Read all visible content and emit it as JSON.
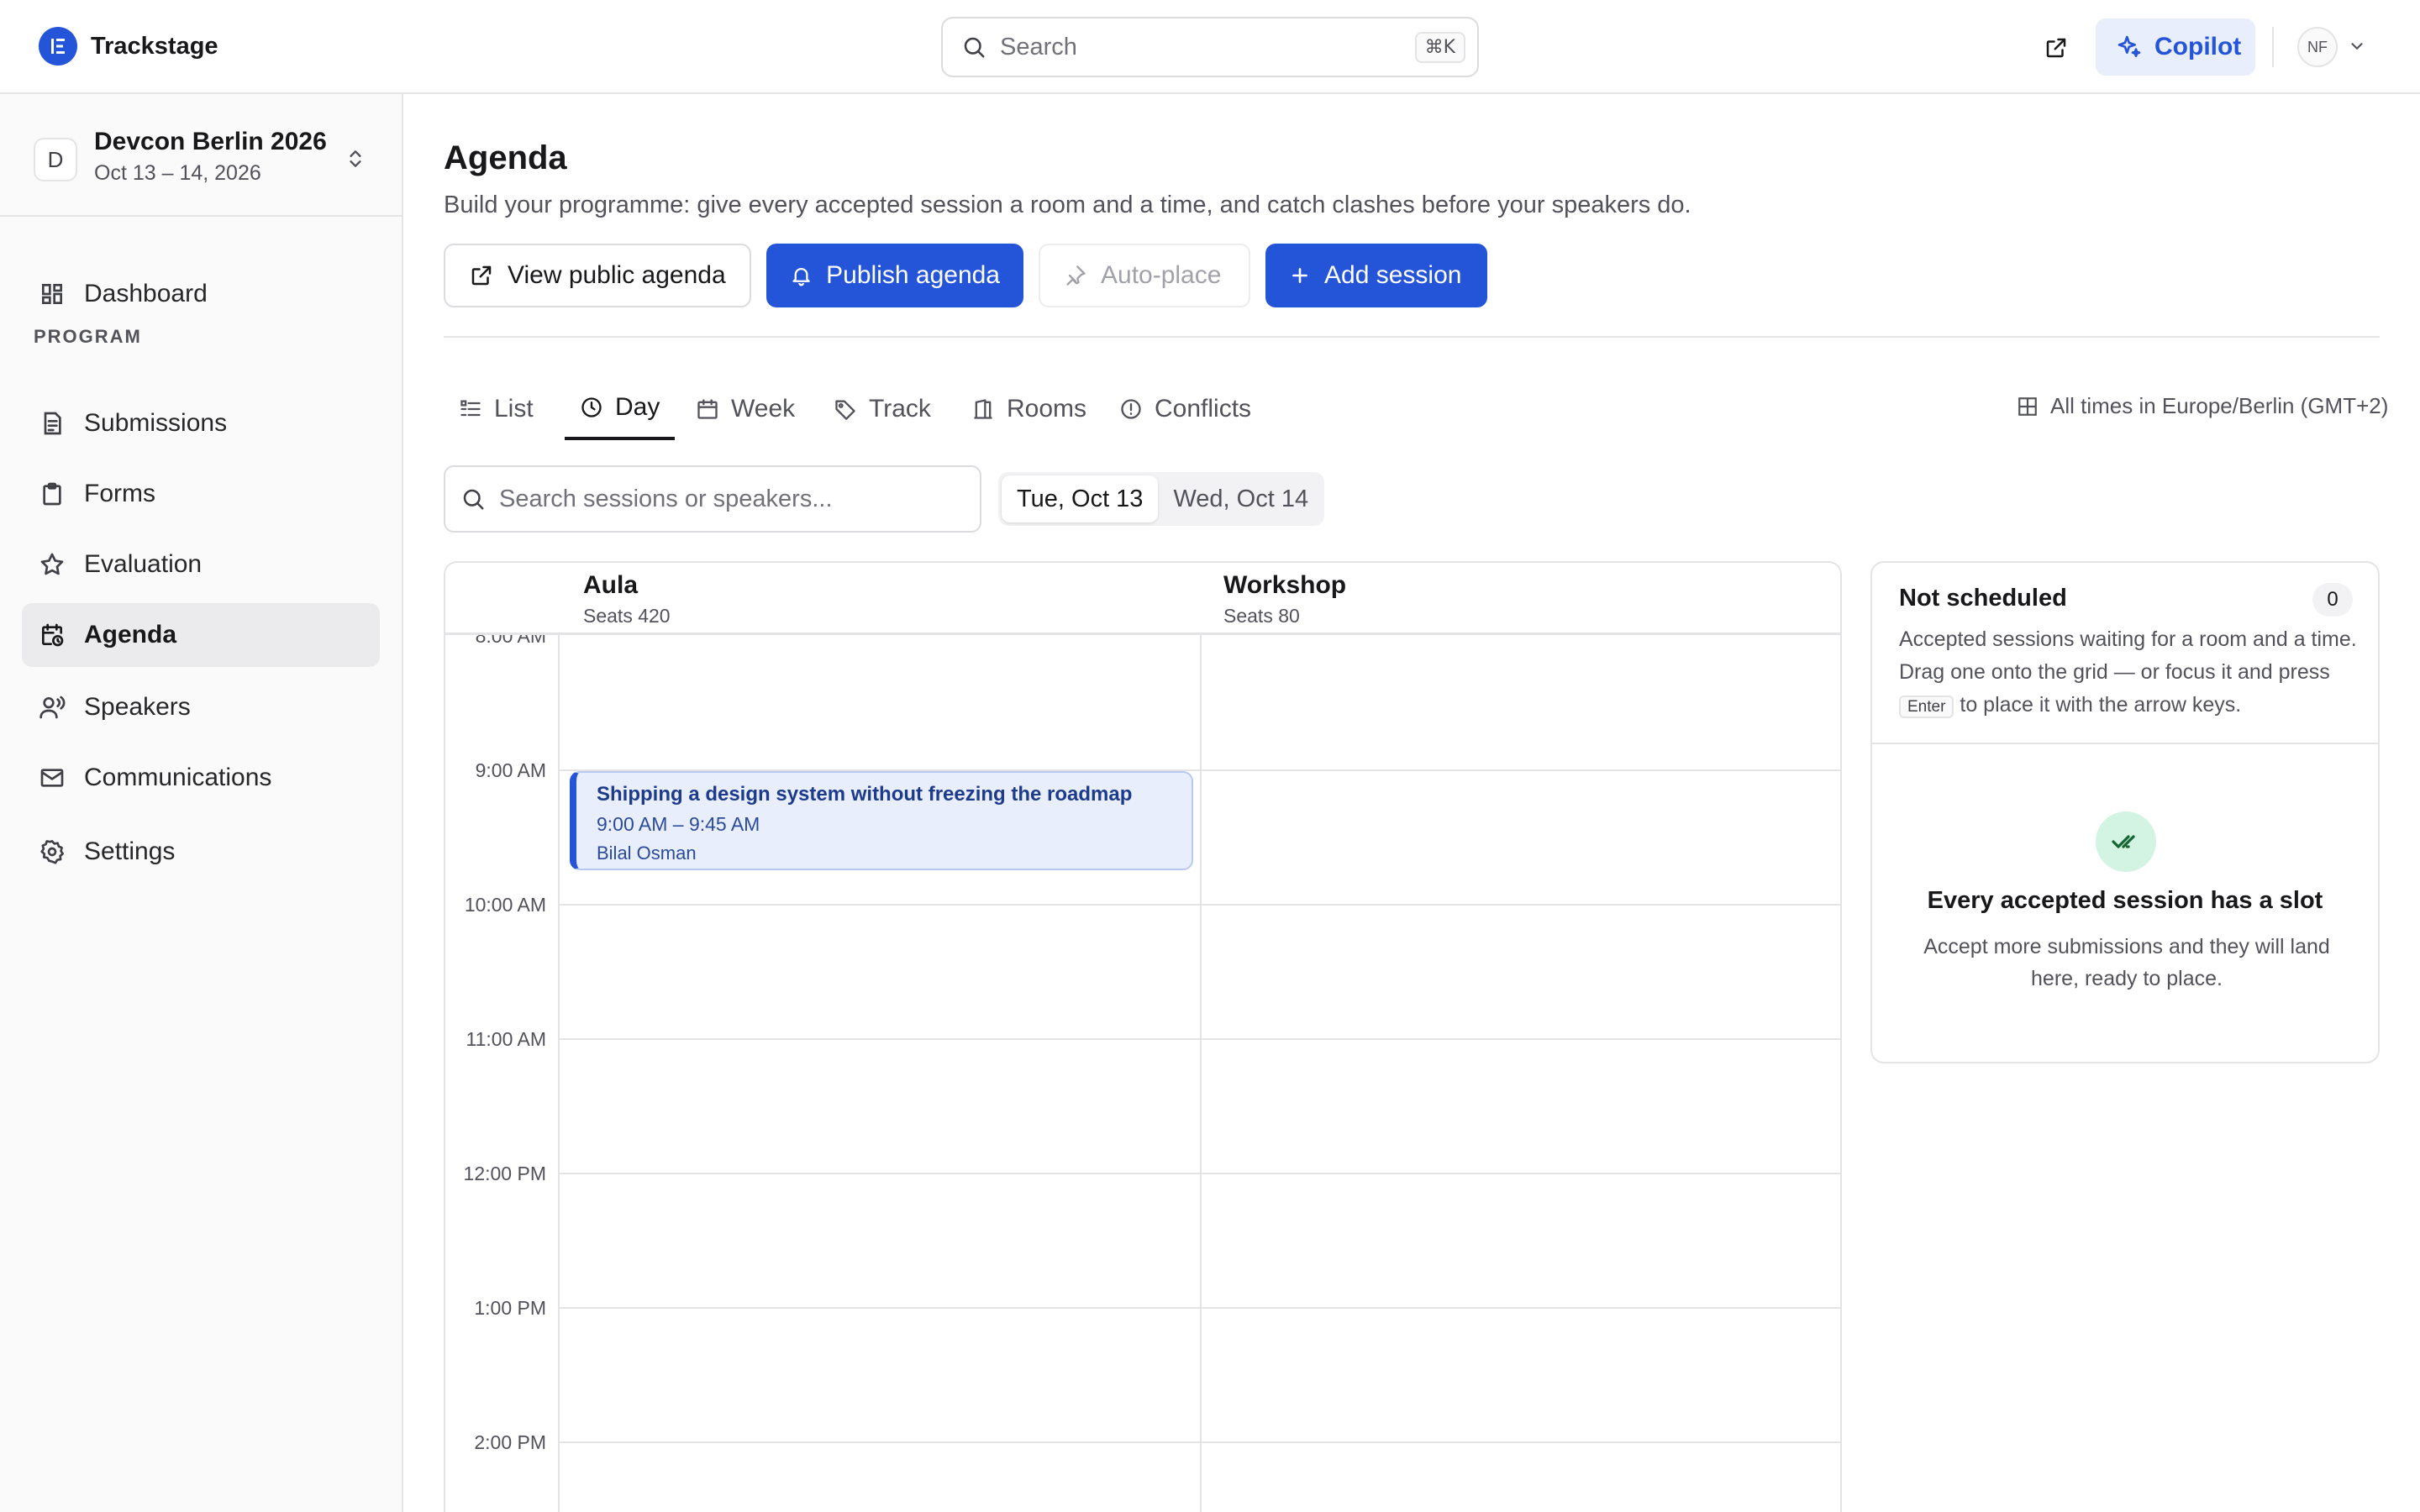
{
  "app": {
    "name": "Trackstage"
  },
  "topbar": {
    "search_placeholder": "Search",
    "search_shortcut": "⌘K",
    "copilot_label": "Copilot",
    "user_initials": "NF",
    "accent": "#2454d8"
  },
  "sidebar": {
    "event_initial": "D",
    "event_name": "Devcon Berlin 2026",
    "event_dates": "Oct 13 – 14, 2026",
    "dashboard": "Dashboard",
    "section_heading": "PROGRAM",
    "items": [
      {
        "label": "Submissions",
        "icon": "submissions-icon"
      },
      {
        "label": "Forms",
        "icon": "clipboard-icon"
      },
      {
        "label": "Evaluation",
        "icon": "star-icon"
      },
      {
        "label": "Agenda",
        "icon": "calendar-clock-icon",
        "active": true
      },
      {
        "label": "Speakers",
        "icon": "speaker-icon"
      },
      {
        "label": "Communications",
        "icon": "mail-icon"
      },
      {
        "label": "Settings",
        "icon": "gear-icon"
      }
    ]
  },
  "page": {
    "title": "Agenda",
    "subtitle": "Build your programme: give every accepted session a room and a time, and catch clashes before your speakers do.",
    "buttons": {
      "view_public": "View public agenda",
      "publish": "Publish agenda",
      "auto_place": "Auto-place",
      "add_session": "Add session"
    }
  },
  "tabs": [
    {
      "label": "List"
    },
    {
      "label": "Day",
      "active": true
    },
    {
      "label": "Week"
    },
    {
      "label": "Track"
    },
    {
      "label": "Rooms"
    },
    {
      "label": "Conflicts"
    }
  ],
  "timezone_note": "All times in Europe/Berlin (GMT+2)",
  "filters": {
    "search_placeholder": "Search sessions or speakers...",
    "days": [
      "Tue, Oct 13",
      "Wed, Oct 14"
    ],
    "selected_day": "Tue, Oct 13"
  },
  "grid": {
    "rooms": [
      {
        "name": "Aula",
        "seats": "Seats 420"
      },
      {
        "name": "Workshop",
        "seats": "Seats 80"
      }
    ],
    "hours": [
      "8:00 AM",
      "9:00 AM",
      "10:00 AM",
      "11:00 AM",
      "12:00 PM",
      "1:00 PM",
      "2:00 PM"
    ],
    "sessions": [
      {
        "title": "Shipping a design system without freezing the roadmap",
        "time": "9:00 AM – 9:45 AM",
        "speaker": "Bilal Osman",
        "room": "Aula"
      }
    ]
  },
  "unscheduled": {
    "title": "Not scheduled",
    "count": "0",
    "desc_before": "Accepted sessions waiting for a room and a time. Drag one onto the grid — or focus it and press",
    "kbd": "Enter",
    "desc_after": "to place it with the arrow keys.",
    "empty_title": "Every accepted session has a slot",
    "empty_desc": "Accept more submissions and they will land here, ready to place."
  }
}
